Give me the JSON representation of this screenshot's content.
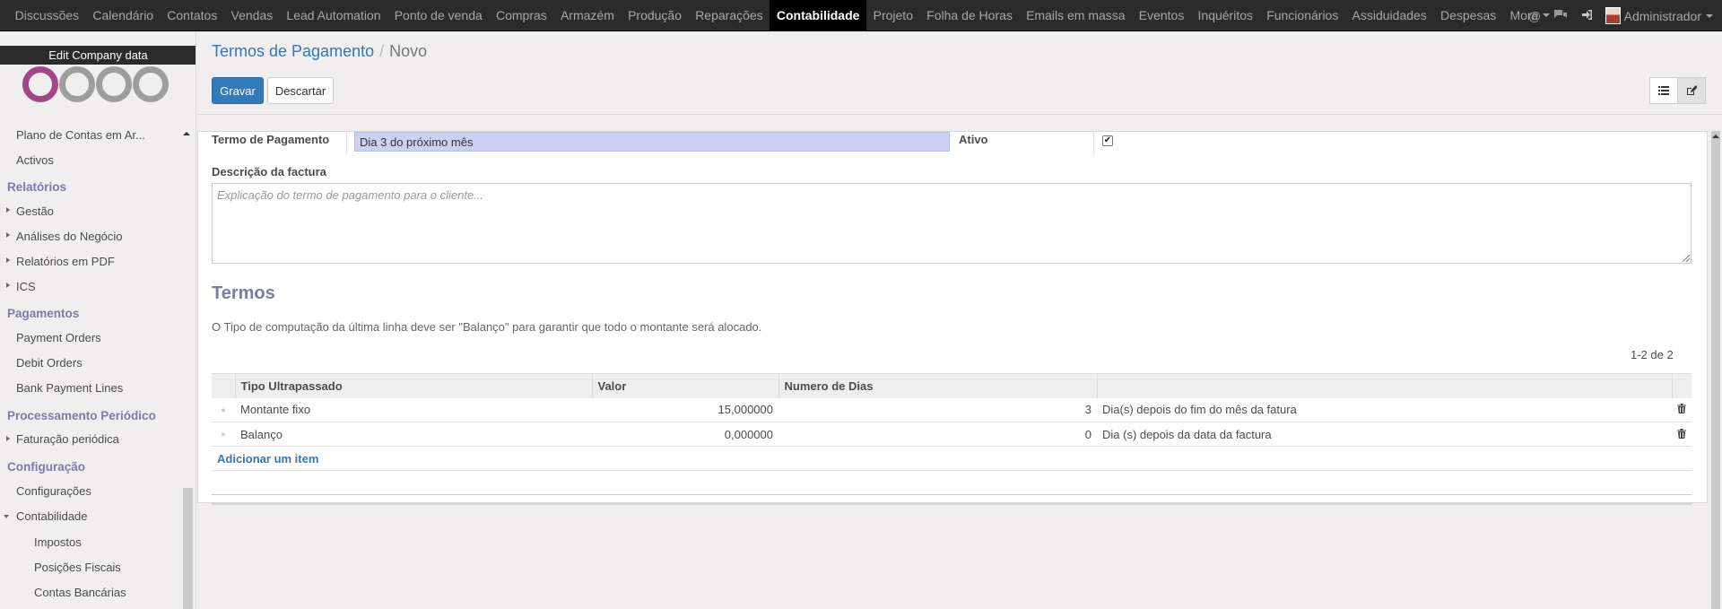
{
  "topbar": {
    "menu": [
      "Discussões",
      "Calendário",
      "Contatos",
      "Vendas",
      "Lead Automation",
      "Ponto de venda",
      "Compras",
      "Armazém",
      "Produção",
      "Reparações",
      "Contabilidade",
      "Projeto",
      "Folha de Horas",
      "Emails em massa",
      "Eventos",
      "Inquéritos",
      "Funcionários",
      "Assiduidades",
      "Despesas",
      "More"
    ],
    "active": "Contabilidade",
    "user": "Administrador",
    "icons": [
      "at-icon",
      "chat-icon",
      "sign-in-icon"
    ]
  },
  "sidebar": {
    "company_button": "Edit Company data",
    "items_top": [
      "Plano de Contas em Ar...",
      "Activos"
    ],
    "sections": {
      "relatorios": "Relatórios",
      "pagamentos": "Pagamentos",
      "processamento": "Processamento Periódico",
      "configuracao": "Configuração"
    },
    "relatorios_items": [
      "Gestão",
      "Análises do Negócio",
      "Relatórios em PDF",
      "ICS"
    ],
    "pagamentos_items": [
      "Payment Orders",
      "Debit Orders",
      "Bank Payment Lines"
    ],
    "processamento_items": [
      "Faturação periódica"
    ],
    "configuracao_items": [
      "Configurações",
      "Contabilidade"
    ],
    "contabilidade_sub": [
      "Impostos",
      "Posições Fiscais",
      "Contas Bancárias"
    ]
  },
  "breadcrumb": {
    "parent": "Termos de Pagamento",
    "current": "Novo"
  },
  "buttons": {
    "save": "Gravar",
    "discard": "Descartar"
  },
  "form": {
    "term_label": "Termo de Pagamento",
    "term_value": "Dia 3 do próximo mês",
    "active_label": "Ativo",
    "active_checked": true,
    "invoice_desc_label": "Descrição da factura",
    "invoice_desc_placeholder": "Explicação do termo de pagamento para o cliente...",
    "section_title": "Termos",
    "help_text": "O Tipo de computação da última linha deve ser \"Balanço\" para garantir que todo o montante será alocado.",
    "pager": "1-2 de 2"
  },
  "lines": {
    "headers": [
      "Tipo Ultrapassado",
      "Valor",
      "Numero de Dias",
      ""
    ],
    "rows": [
      [
        "Montante fixo",
        "15,000000",
        "3",
        "Dia(s) depois do fim do mês da fatura"
      ],
      [
        "Balanço",
        "0,000000",
        "0",
        "Dia (s) depois da data da factura"
      ]
    ],
    "add_item": "Adicionar um item"
  }
}
